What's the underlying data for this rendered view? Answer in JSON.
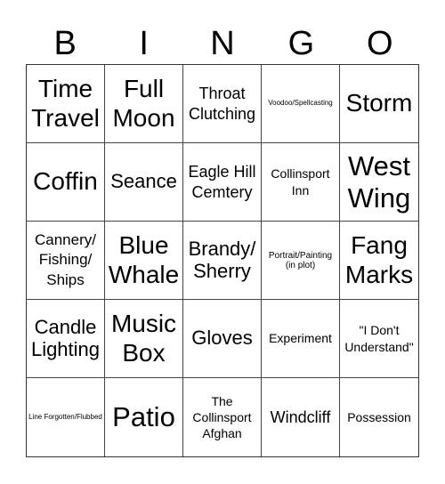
{
  "header": {
    "letters": [
      "B",
      "I",
      "N",
      "G",
      "O"
    ]
  },
  "cells": [
    {
      "text": "Time Travel",
      "size": "lg"
    },
    {
      "text": "Full Moon",
      "size": "lg"
    },
    {
      "text": "Throat Clutching",
      "size": "sm"
    },
    {
      "text": "Voodoo/Spellcasting",
      "size": "tiny"
    },
    {
      "text": "Storm",
      "size": "lg"
    },
    {
      "text": "Coffin",
      "size": "lg"
    },
    {
      "text": "Seance",
      "size": "md"
    },
    {
      "text": "Eagle Hill Cemtery",
      "size": "sm"
    },
    {
      "text": "Collinsport Inn",
      "size": "xs"
    },
    {
      "text": "West Wing",
      "size": "xl"
    },
    {
      "text": "Cannery/ Fishing/ Ships",
      "size": "s2"
    },
    {
      "text": "Blue Whale",
      "size": "lg"
    },
    {
      "text": "Brandy/ Sherry",
      "size": "md"
    },
    {
      "text": "Portrait/Painting (in plot)",
      "size": "xxs"
    },
    {
      "text": "Fang Marks",
      "size": "lg"
    },
    {
      "text": "Candle Lighting",
      "size": "md"
    },
    {
      "text": "Music Box",
      "size": "lg"
    },
    {
      "text": "Gloves",
      "size": "md"
    },
    {
      "text": "Experiment",
      "size": "xs"
    },
    {
      "text": "\"I Don't Understand\"",
      "size": "xs"
    },
    {
      "text": "Line Forgotten/Flubbed",
      "size": "tiny"
    },
    {
      "text": "Patio",
      "size": "xl"
    },
    {
      "text": "The Collinsport Afghan",
      "size": "xs"
    },
    {
      "text": "Windcliff",
      "size": "sm"
    },
    {
      "text": "Possession",
      "size": "xs"
    }
  ]
}
